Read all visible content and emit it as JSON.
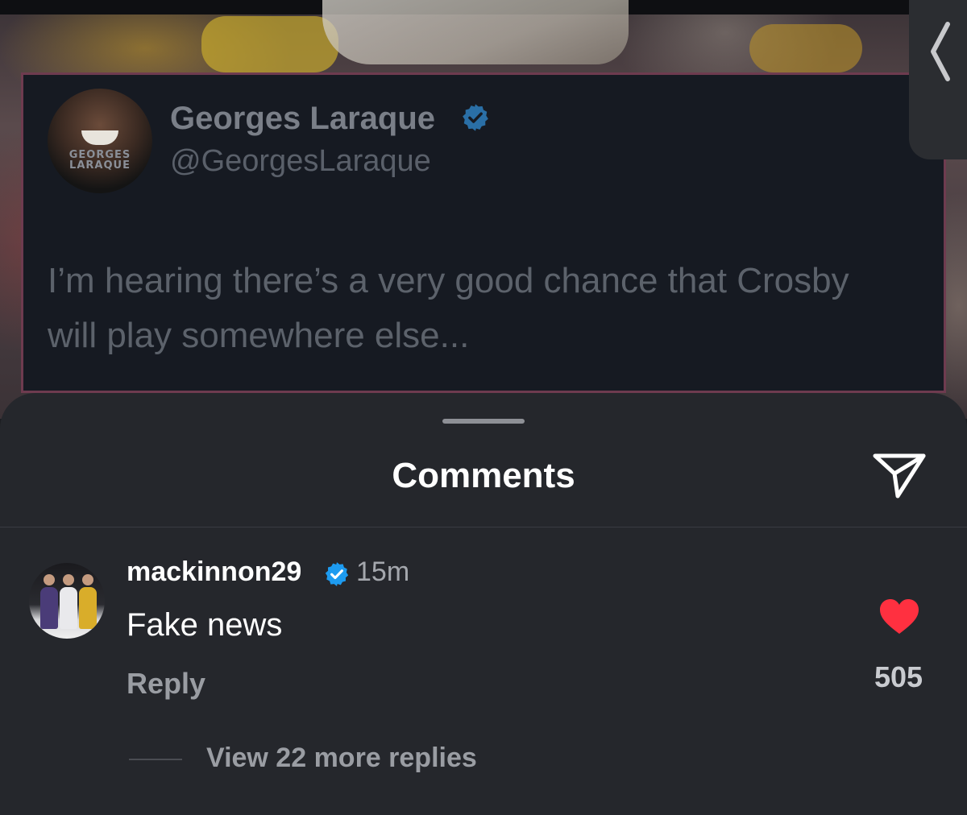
{
  "post": {
    "tweet": {
      "display_name": "Georges Laraque",
      "handle": "@GeorgesLaraque",
      "avatar_caption_line1": "GEORGES",
      "avatar_caption_line2": "LARAQUE",
      "text": "I’m hearing there’s a very good chance that Crosby will play somewhere else...",
      "verified": true
    }
  },
  "comments_sheet": {
    "title": "Comments",
    "comment": {
      "username": "mackinnon29",
      "verified": true,
      "time": "15m",
      "body": "Fake news",
      "reply_label": "Reply",
      "like_count": "505",
      "liked": true,
      "view_replies_label": "View 22 more replies"
    }
  },
  "colors": {
    "verified_blue": "#1d9bf0",
    "like_red": "#ff3040",
    "sheet_bg": "#25272c"
  },
  "icons": {
    "back": "chevron-left-icon",
    "share": "paper-plane-icon",
    "like": "heart-icon",
    "verified": "verified-check-icon"
  }
}
